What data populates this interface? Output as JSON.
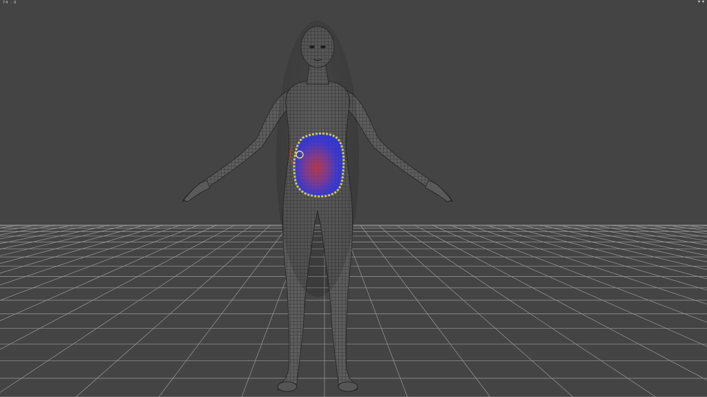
{
  "viewport": {
    "hud_text": "74 · 0",
    "background": "#444444",
    "grid_color": "#9a9a9a",
    "mesh_fill": "#5e5e5e",
    "wire_color": "#2e2e2e",
    "weight_cold": "#2b2fe6",
    "weight_hot": "#b8324f",
    "brush_ring": "#e3e36a",
    "corner_icons": [
      "expand-icon",
      "chevron-down-icon"
    ]
  }
}
